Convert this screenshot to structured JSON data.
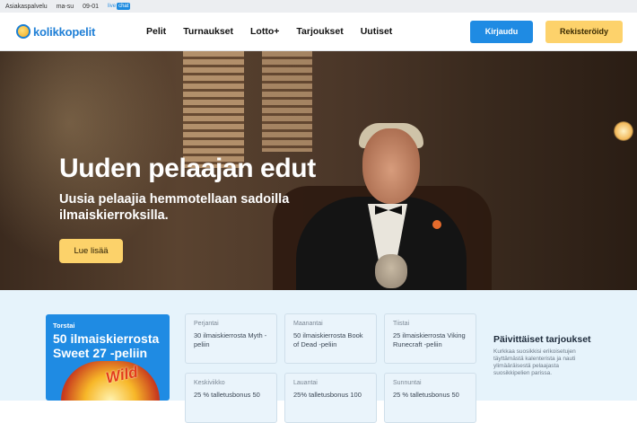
{
  "topbar": {
    "support": "Asiakaspalvelu",
    "days": "ma-su",
    "hours": "09-01",
    "live": "live",
    "chat": "chat"
  },
  "nav": {
    "logo": "kolikkopelit",
    "items": [
      "Pelit",
      "Turnaukset",
      "Lotto+",
      "Tarjoukset",
      "Uutiset"
    ],
    "login": "Kirjaudu",
    "register": "Rekisteröidy"
  },
  "hero": {
    "title": "Uuden pelaajan edut",
    "subtitle": "Uusia pelaajia hemmotellaan sadoilla ilmaiskierroksilla.",
    "cta": "Lue lisää"
  },
  "feature": {
    "day": "Torstai",
    "text": "50 ilmaiskierrosta Sweet 27 -peliin",
    "badge": "Wild"
  },
  "offers": [
    {
      "day": "Perjantai",
      "text": "30 ilmaiskierrosta Myth -peliin"
    },
    {
      "day": "Maanantai",
      "text": "50 ilmaiskierrosta Book of Dead -peliin"
    },
    {
      "day": "Tiistai",
      "text": "25 ilmaiskierrosta Viking Runecraft -peliin"
    },
    {
      "day": "Keskiviikko",
      "text": "25 % talletusbonus 50"
    },
    {
      "day": "Lauantai",
      "text": "25% talletusbonus 100"
    },
    {
      "day": "Sunnuntai",
      "text": "25 % talletusbonus 50"
    }
  ],
  "side": {
    "title": "Päivittäiset tarjoukset",
    "text": "Kurkkaa suosikkisi erikoisetujen täyttämästä kalenterista ja nauti ylimääräisestä pelaajasta suosikkipelien parissa."
  },
  "colors": {
    "primary": "#1f8be3",
    "accent": "#fdd26b"
  }
}
